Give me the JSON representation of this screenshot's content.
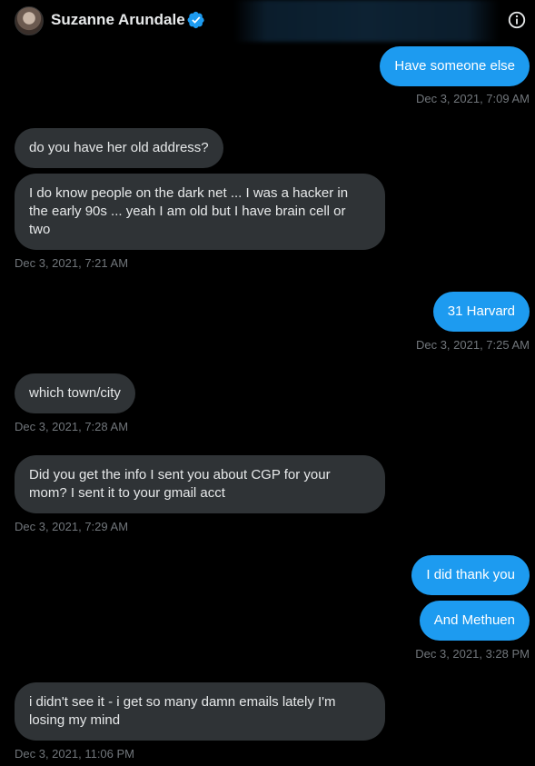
{
  "header": {
    "name": "Suzanne Arundale",
    "verified_icon": "verified-badge-icon",
    "info_icon": "info-icon"
  },
  "colors": {
    "sent_bubble": "#1d9bf0",
    "received_bubble": "#2f3336",
    "timestamp": "#71767b",
    "background": "#000000"
  },
  "messages": [
    {
      "direction": "sent",
      "text": "Have someone else",
      "timestamp": "Dec 3, 2021, 7:09 AM"
    },
    {
      "direction": "received",
      "text": "do you have her old address?"
    },
    {
      "direction": "received",
      "text": "I do know people on the dark net ... I was a hacker in the early 90s ... yeah I am old but I have brain cell or two",
      "timestamp": "Dec 3, 2021, 7:21 AM"
    },
    {
      "direction": "sent",
      "text": "31 Harvard",
      "timestamp": "Dec 3, 2021, 7:25 AM"
    },
    {
      "direction": "received",
      "text": "which town/city",
      "timestamp": "Dec 3, 2021, 7:28 AM"
    },
    {
      "direction": "received",
      "text": "Did you get the info I sent you about CGP for your mom?  I sent it to your gmail acct",
      "timestamp": "Dec 3, 2021, 7:29 AM"
    },
    {
      "direction": "sent",
      "text": "I did thank you"
    },
    {
      "direction": "sent",
      "text": "And Methuen",
      "timestamp": "Dec 3, 2021, 3:28 PM"
    },
    {
      "direction": "received",
      "text": "i didn't see it - i get so many damn emails lately I'm losing my mind",
      "timestamp": "Dec 3, 2021, 11:06 PM"
    }
  ]
}
